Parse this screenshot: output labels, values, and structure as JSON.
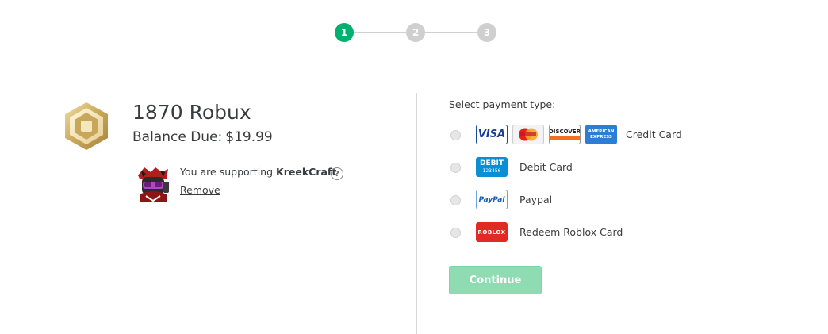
{
  "stepper": {
    "steps": [
      "1",
      "2",
      "3"
    ],
    "active_step": 1,
    "colors": {
      "active": "#00b06f",
      "inactive": "#cfcfcf"
    }
  },
  "product": {
    "name": "1870 Robux",
    "balance_label": "Balance Due:",
    "balance_amount": "$19.99"
  },
  "supporter": {
    "text": "You are supporting",
    "name": "KreekCraft",
    "remove_label": "Remove",
    "help_glyph": "?"
  },
  "payment": {
    "heading": "Select payment type:",
    "options": [
      {
        "label": "Credit Card",
        "icons": [
          "visa-logo",
          "mastercard-logo",
          "discover-logo",
          "american-express-logo"
        ],
        "logo_text": [
          "VISA",
          "",
          "DISCOVER",
          "AMERICAN EXPRESS"
        ]
      },
      {
        "label": "Debit Card",
        "icons": [
          "debit-card-logo"
        ],
        "logo_text": [
          "DEBIT",
          "123456"
        ]
      },
      {
        "label": "Paypal",
        "icons": [
          "paypal-logo"
        ],
        "logo_text": [
          "PayPal"
        ]
      },
      {
        "label": "Redeem Roblox Card",
        "icons": [
          "roblox-card-logo"
        ],
        "logo_text": [
          "ROBLOX"
        ]
      }
    ]
  },
  "continue_label": "Continue",
  "colors": {
    "accent": "#00b06f",
    "continue_disabled": "#8fdcb2"
  }
}
